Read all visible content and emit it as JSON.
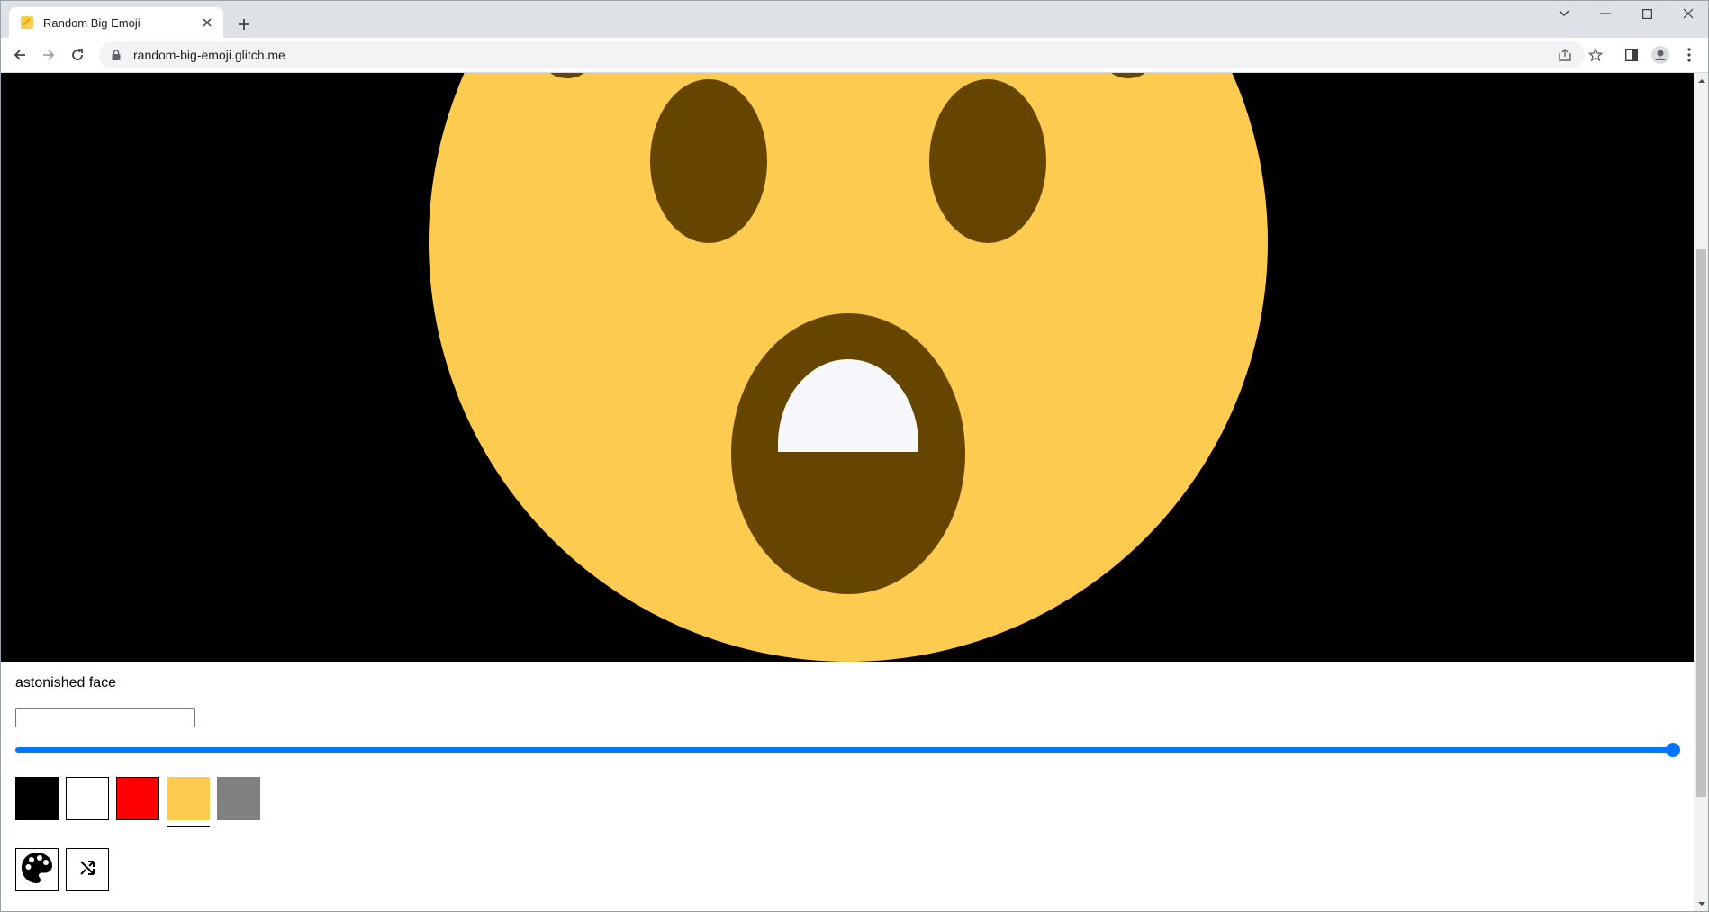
{
  "browser": {
    "tab_title": "Random Big Emoji",
    "url": "random-big-emoji.glitch.me"
  },
  "page": {
    "emoji_name": "astonished face",
    "name_input_value": "",
    "size_slider_value": 1.0,
    "swatches": [
      {
        "name": "black",
        "color": "#000000",
        "selected": false
      },
      {
        "name": "white",
        "color": "#ffffff",
        "selected": false
      },
      {
        "name": "red",
        "color": "#ff0000",
        "selected": false
      },
      {
        "name": "yellow",
        "color": "#fdcb4f",
        "selected": true
      },
      {
        "name": "gray",
        "color": "#808080",
        "selected": false
      }
    ],
    "tools": [
      "palette-icon",
      "shuffle-icon"
    ]
  },
  "colors": {
    "face": "#fdcb4f",
    "feature": "#664500",
    "teeth": "#f5f7fa",
    "stage_background": "#000000",
    "accent": "#0075ff"
  }
}
